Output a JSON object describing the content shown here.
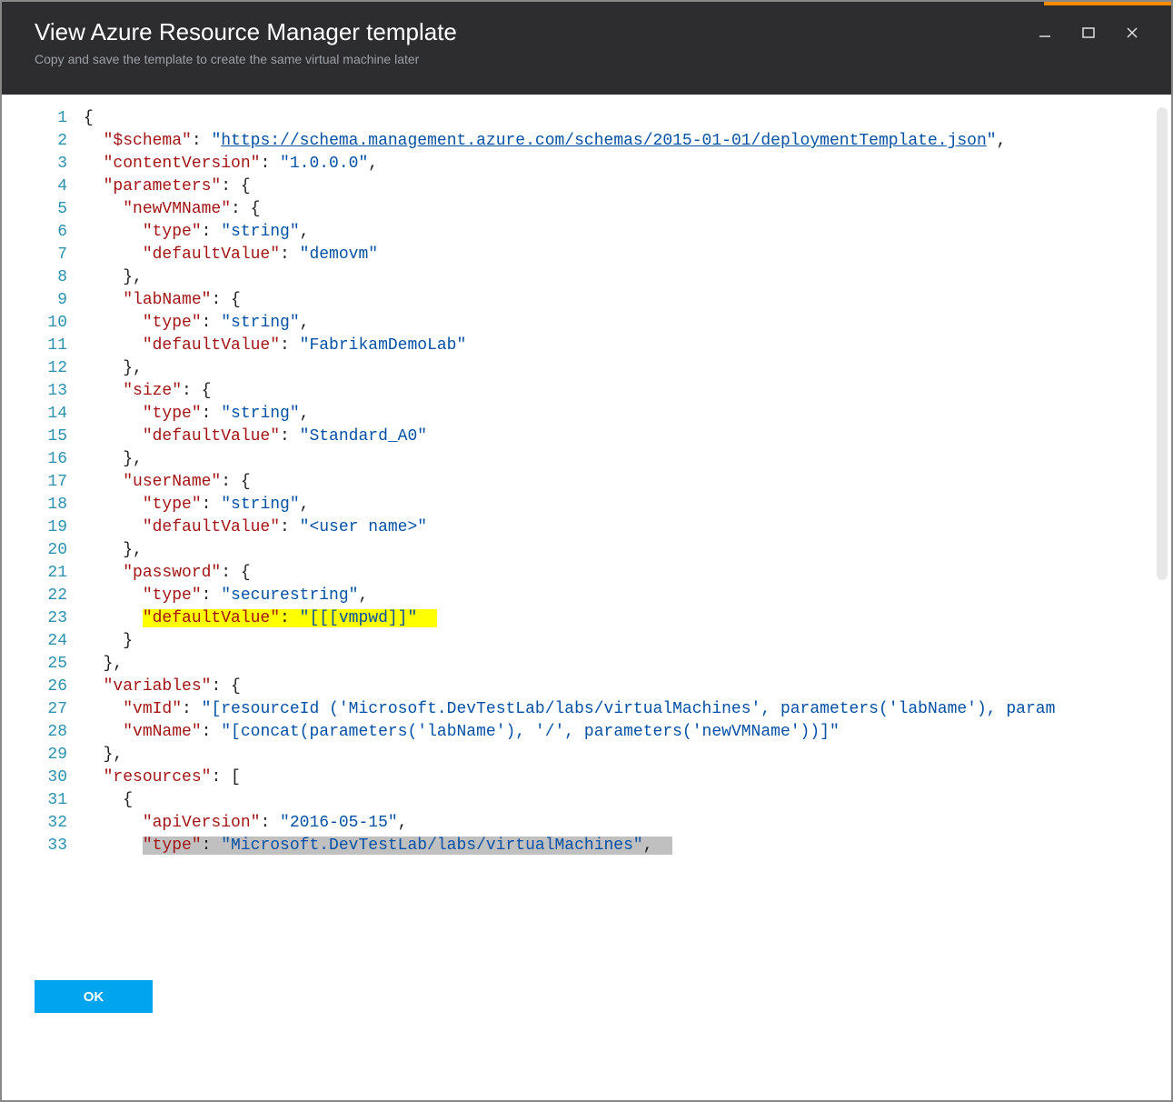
{
  "window": {
    "title": "View Azure Resource Manager template",
    "subtitle": "Copy and save the template to create the same virtual machine later"
  },
  "buttons": {
    "ok": "OK"
  },
  "code": {
    "lines": [
      {
        "n": 1,
        "tokens": [
          [
            "punc",
            "{"
          ]
        ]
      },
      {
        "n": 2,
        "tokens": [
          [
            "punc",
            "  "
          ],
          [
            "key",
            "\"$schema\""
          ],
          [
            "punc",
            ": "
          ],
          [
            "str",
            "\""
          ],
          [
            "link",
            "https://schema.management.azure.com/schemas/2015-01-01/deploymentTemplate.json"
          ],
          [
            "str",
            "\""
          ],
          [
            "punc",
            ","
          ]
        ]
      },
      {
        "n": 3,
        "tokens": [
          [
            "punc",
            "  "
          ],
          [
            "key",
            "\"contentVersion\""
          ],
          [
            "punc",
            ": "
          ],
          [
            "str",
            "\"1.0.0.0\""
          ],
          [
            "punc",
            ","
          ]
        ]
      },
      {
        "n": 4,
        "tokens": [
          [
            "punc",
            "  "
          ],
          [
            "key",
            "\"parameters\""
          ],
          [
            "punc",
            ": {"
          ]
        ]
      },
      {
        "n": 5,
        "tokens": [
          [
            "punc",
            "    "
          ],
          [
            "key",
            "\"newVMName\""
          ],
          [
            "punc",
            ": {"
          ]
        ]
      },
      {
        "n": 6,
        "tokens": [
          [
            "punc",
            "      "
          ],
          [
            "key",
            "\"type\""
          ],
          [
            "punc",
            ": "
          ],
          [
            "str",
            "\"string\""
          ],
          [
            "punc",
            ","
          ]
        ]
      },
      {
        "n": 7,
        "tokens": [
          [
            "punc",
            "      "
          ],
          [
            "key",
            "\"defaultValue\""
          ],
          [
            "punc",
            ": "
          ],
          [
            "str",
            "\"demovm\""
          ]
        ]
      },
      {
        "n": 8,
        "tokens": [
          [
            "punc",
            "    },"
          ]
        ]
      },
      {
        "n": 9,
        "tokens": [
          [
            "punc",
            "    "
          ],
          [
            "key",
            "\"labName\""
          ],
          [
            "punc",
            ": {"
          ]
        ]
      },
      {
        "n": 10,
        "tokens": [
          [
            "punc",
            "      "
          ],
          [
            "key",
            "\"type\""
          ],
          [
            "punc",
            ": "
          ],
          [
            "str",
            "\"string\""
          ],
          [
            "punc",
            ","
          ]
        ]
      },
      {
        "n": 11,
        "tokens": [
          [
            "punc",
            "      "
          ],
          [
            "key",
            "\"defaultValue\""
          ],
          [
            "punc",
            ": "
          ],
          [
            "str",
            "\"FabrikamDemoLab\""
          ]
        ]
      },
      {
        "n": 12,
        "tokens": [
          [
            "punc",
            "    },"
          ]
        ]
      },
      {
        "n": 13,
        "tokens": [
          [
            "punc",
            "    "
          ],
          [
            "key",
            "\"size\""
          ],
          [
            "punc",
            ": {"
          ]
        ]
      },
      {
        "n": 14,
        "tokens": [
          [
            "punc",
            "      "
          ],
          [
            "key",
            "\"type\""
          ],
          [
            "punc",
            ": "
          ],
          [
            "str",
            "\"string\""
          ],
          [
            "punc",
            ","
          ]
        ]
      },
      {
        "n": 15,
        "tokens": [
          [
            "punc",
            "      "
          ],
          [
            "key",
            "\"defaultValue\""
          ],
          [
            "punc",
            ": "
          ],
          [
            "str",
            "\"Standard_A0\""
          ]
        ]
      },
      {
        "n": 16,
        "tokens": [
          [
            "punc",
            "    },"
          ]
        ]
      },
      {
        "n": 17,
        "tokens": [
          [
            "punc",
            "    "
          ],
          [
            "key",
            "\"userName\""
          ],
          [
            "punc",
            ": {"
          ]
        ]
      },
      {
        "n": 18,
        "tokens": [
          [
            "punc",
            "      "
          ],
          [
            "key",
            "\"type\""
          ],
          [
            "punc",
            ": "
          ],
          [
            "str",
            "\"string\""
          ],
          [
            "punc",
            ","
          ]
        ]
      },
      {
        "n": 19,
        "tokens": [
          [
            "punc",
            "      "
          ],
          [
            "key",
            "\"defaultValue\""
          ],
          [
            "punc",
            ": "
          ],
          [
            "str",
            "\"<user name>\""
          ]
        ]
      },
      {
        "n": 20,
        "tokens": [
          [
            "punc",
            "    },"
          ]
        ]
      },
      {
        "n": 21,
        "tokens": [
          [
            "punc",
            "    "
          ],
          [
            "key",
            "\"password\""
          ],
          [
            "punc",
            ": {"
          ]
        ]
      },
      {
        "n": 22,
        "tokens": [
          [
            "punc",
            "      "
          ],
          [
            "key",
            "\"type\""
          ],
          [
            "punc",
            ": "
          ],
          [
            "str",
            "\"securestring\""
          ],
          [
            "punc",
            ","
          ]
        ]
      },
      {
        "n": 23,
        "hl": "yellow",
        "tokens": [
          [
            "punc",
            "      "
          ],
          [
            "key",
            "\"defaultValue\""
          ],
          [
            "punc",
            ": "
          ],
          [
            "str",
            "\"[[[vmpwd]]\""
          ]
        ]
      },
      {
        "n": 24,
        "tokens": [
          [
            "punc",
            "    }"
          ]
        ]
      },
      {
        "n": 25,
        "tokens": [
          [
            "punc",
            "  },"
          ]
        ]
      },
      {
        "n": 26,
        "tokens": [
          [
            "punc",
            "  "
          ],
          [
            "key",
            "\"variables\""
          ],
          [
            "punc",
            ": {"
          ]
        ]
      },
      {
        "n": 27,
        "tokens": [
          [
            "punc",
            "    "
          ],
          [
            "key",
            "\"vmId\""
          ],
          [
            "punc",
            ": "
          ],
          [
            "str",
            "\"[resourceId ('Microsoft.DevTestLab/labs/virtualMachines', parameters('labName'), param"
          ]
        ]
      },
      {
        "n": 28,
        "tokens": [
          [
            "punc",
            "    "
          ],
          [
            "key",
            "\"vmName\""
          ],
          [
            "punc",
            ": "
          ],
          [
            "str",
            "\"[concat(parameters('labName'), '/', parameters('newVMName'))]\""
          ]
        ]
      },
      {
        "n": 29,
        "tokens": [
          [
            "punc",
            "  },"
          ]
        ]
      },
      {
        "n": 30,
        "tokens": [
          [
            "punc",
            "  "
          ],
          [
            "key",
            "\"resources\""
          ],
          [
            "punc",
            ": ["
          ]
        ]
      },
      {
        "n": 31,
        "tokens": [
          [
            "punc",
            "    {"
          ]
        ]
      },
      {
        "n": 32,
        "tokens": [
          [
            "punc",
            "      "
          ],
          [
            "key",
            "\"apiVersion\""
          ],
          [
            "punc",
            ": "
          ],
          [
            "str",
            "\"2016-05-15\""
          ],
          [
            "punc",
            ","
          ]
        ]
      },
      {
        "n": 33,
        "hl": "gray",
        "tokens": [
          [
            "punc",
            "      "
          ],
          [
            "key",
            "\"type\""
          ],
          [
            "punc",
            ": "
          ],
          [
            "str",
            "\"Microsoft.DevTestLab/labs/virtualMachines\""
          ],
          [
            "punc",
            ","
          ]
        ]
      }
    ]
  }
}
